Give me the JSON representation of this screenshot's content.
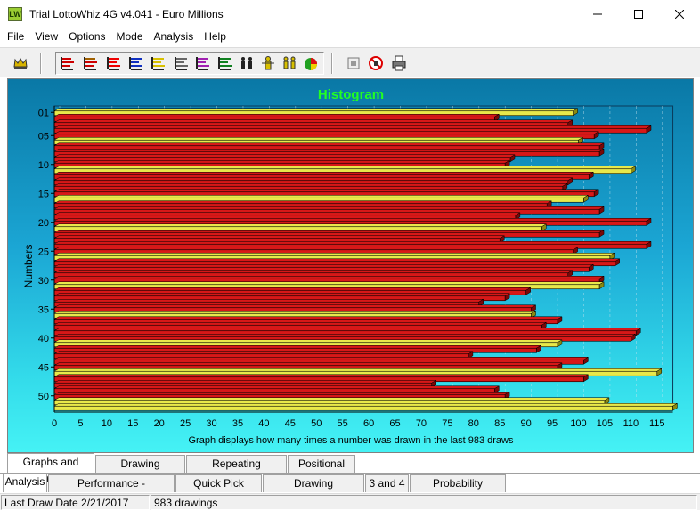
{
  "window": {
    "title": "Trial LottoWhiz 4G v4.041 - Euro Millions",
    "icon_text": "LW"
  },
  "menu": [
    "File",
    "View",
    "Options",
    "Mode",
    "Analysis",
    "Help"
  ],
  "toolbar": {
    "icons": [
      "crown-icon",
      "histogram-icon",
      "histogram-alt-icon",
      "histogram-red-icon",
      "histogram-blue-icon",
      "histogram-yellow-icon",
      "histogram-gray-icon",
      "histogram-purple-icon",
      "histogram-green-icon",
      "people-icon",
      "yellow-people-icon",
      "grid-people-icon",
      "pie-chart-icon",
      "stop-icon",
      "no-icon",
      "printer-icon"
    ]
  },
  "chart_data": {
    "type": "bar",
    "orientation": "horizontal",
    "title": "Histogram",
    "ylabel": "Numbers",
    "caption": "Graph displays how many times a number was drawn in the last 983 draws",
    "xlim": [
      0,
      117
    ],
    "xticks": [
      0,
      5,
      10,
      15,
      20,
      25,
      30,
      35,
      40,
      45,
      50,
      55,
      60,
      65,
      70,
      75,
      80,
      85,
      90,
      95,
      100,
      105,
      110,
      115
    ],
    "ytick_labels": [
      "01",
      "05",
      "10",
      "15",
      "20",
      "25",
      "30",
      "35",
      "40",
      "45",
      "50"
    ],
    "categories": [
      "01",
      "02",
      "03",
      "04",
      "05",
      "06",
      "07",
      "08",
      "09",
      "10",
      "11",
      "12",
      "13",
      "14",
      "15",
      "16",
      "17",
      "18",
      "19",
      "20",
      "21",
      "22",
      "23",
      "24",
      "25",
      "26",
      "27",
      "28",
      "29",
      "30",
      "31",
      "32",
      "33",
      "34",
      "35",
      "36",
      "37",
      "38",
      "39",
      "40",
      "41",
      "42",
      "43",
      "44",
      "45",
      "46",
      "47",
      "48",
      "49",
      "50"
    ],
    "values": [
      99,
      84,
      98,
      113,
      103,
      100,
      104,
      104,
      87,
      86,
      110,
      102,
      98,
      97,
      103,
      101,
      94,
      104,
      88,
      113,
      93,
      104,
      85,
      113,
      99,
      106,
      107,
      102,
      98,
      104,
      104,
      90,
      86,
      81,
      91,
      91,
      96,
      93,
      111,
      110,
      96,
      92,
      79,
      101,
      96,
      115,
      101,
      72,
      84,
      86,
      105,
      118
    ],
    "highlight_color": "#e8e84a",
    "bar_color": "#d71818",
    "colors": {
      "title": "#22ff22",
      "grid": "#c8e4ee"
    }
  },
  "tabs_upper": [
    "Graphs and Charts",
    "Drawing Groupings",
    "Repeating Frequency",
    "Positional Hits"
  ],
  "tabs_lower": [
    "Analysis",
    "Performance - Combinations",
    "Quick Pick Center",
    "Drawing Maintenance",
    "3 and 4",
    "Probability Calculator"
  ],
  "status": {
    "last_draw": "Last Draw Date 2/21/2017",
    "drawings": "983 drawings"
  }
}
